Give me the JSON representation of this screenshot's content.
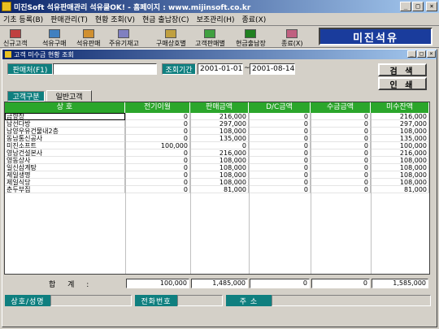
{
  "window": {
    "title": "미진Soft 석유판매관리 석유쿨OK! - 홈페이지 : www.mijinsoft.co.kr",
    "buttons": {
      "minimize": "_",
      "maximize": "□",
      "close": "×"
    }
  },
  "menu": [
    "기초 등록(B)",
    "판매관리(T)",
    "현황 조회(V)",
    "현금 출납장(C)",
    "보조관리(H)",
    "종료(X)"
  ],
  "toolbar": {
    "items": [
      "신규고객",
      "석유구매",
      "석유판매",
      "주유기재고",
      "구매상호별",
      "고객판매별",
      "현금출납장",
      "종료(X)"
    ],
    "icon_colors": [
      "#c04040",
      "#4080c0",
      "#d09030",
      "#8080c0",
      "#c0a040",
      "#40a040",
      "#208020",
      "#c06080"
    ],
    "brand": "미진석유"
  },
  "subwindow": {
    "title": "고객 미수금 현황 조회",
    "buttons": {
      "minimize": "_",
      "maximize": "□",
      "close": "×"
    }
  },
  "filters": {
    "seller_label": "판매처(F1)",
    "seller_value": "",
    "period_label": "조회기간",
    "date_from": "2001-01-01",
    "date_sep": "~",
    "date_to": "2001-08-14",
    "search_button": "검 색",
    "print_button": "인 쇄",
    "customer_type_label": "고객구분",
    "customer_type_tab": "일반고객"
  },
  "table": {
    "columns": [
      "상 호",
      "전기이월",
      "판매금액",
      "D/C금액",
      "수금금액",
      "미수잔액"
    ],
    "rows": [
      [
        "금향장",
        "0",
        "216,000",
        "0",
        "0",
        "216,000"
      ],
      [
        "남선다방",
        "0",
        "297,000",
        "0",
        "0",
        "297,000"
      ],
      [
        "남양우유건물내2층",
        "0",
        "108,000",
        "0",
        "0",
        "108,000"
      ],
      [
        "동남통신공사",
        "0",
        "135,000",
        "0",
        "0",
        "135,000"
      ],
      [
        "미진소프트",
        "100,000",
        "0",
        "0",
        "0",
        "100,000"
      ],
      [
        "영남건설본사",
        "0",
        "216,000",
        "0",
        "0",
        "216,000"
      ],
      [
        "영동상사",
        "0",
        "108,000",
        "0",
        "0",
        "108,000"
      ],
      [
        "일신삼계탕",
        "0",
        "108,000",
        "0",
        "0",
        "108,000"
      ],
      [
        "제일생명",
        "0",
        "108,000",
        "0",
        "0",
        "108,000"
      ],
      [
        "제일식당",
        "0",
        "108,000",
        "0",
        "0",
        "108,000"
      ],
      [
        "춘두부집",
        "0",
        "81,000",
        "0",
        "0",
        "81,000"
      ]
    ]
  },
  "totals": {
    "label": "합 계 :",
    "values": [
      "100,000",
      "1,485,000",
      "0",
      "0",
      "1,585,000"
    ]
  },
  "statusbar": {
    "name_label": "상호/성명",
    "phone_label": "전화번호",
    "address_label": "주 소"
  }
}
